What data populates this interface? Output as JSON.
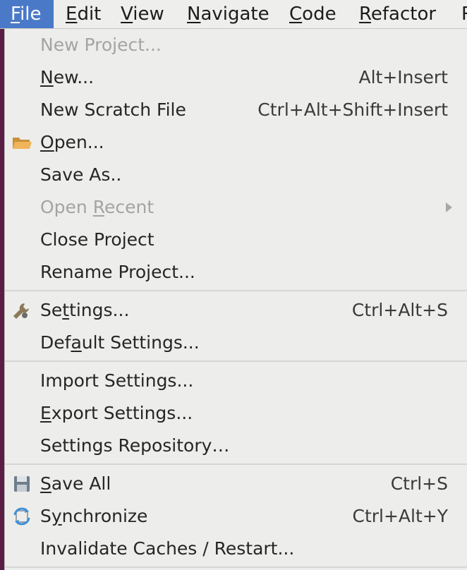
{
  "menubar": {
    "items": [
      {
        "label": "File",
        "mn": "F",
        "rest": "ile"
      },
      {
        "label": "Edit",
        "mn": "E",
        "rest": "dit"
      },
      {
        "label": "View",
        "mn": "V",
        "rest": "iew"
      },
      {
        "label": "Navigate",
        "mn": "N",
        "rest": "avigate"
      },
      {
        "label": "Code",
        "mn": "C",
        "rest": "ode"
      },
      {
        "label": "Refactor",
        "mn": "R",
        "rest": "efactor"
      },
      {
        "label": "R",
        "mn": "",
        "rest": "R"
      }
    ]
  },
  "file_menu": {
    "items": [
      {
        "label": "New Project...",
        "pre": "New Project...",
        "mn": "",
        "post": "",
        "shortcut": "",
        "disabled": true
      },
      {
        "label": "New...",
        "pre": "",
        "mn": "N",
        "post": "ew...",
        "shortcut": "Alt+Insert",
        "disabled": false
      },
      {
        "label": "New Scratch File",
        "pre": "New Scratch File",
        "mn": "",
        "post": "",
        "shortcut": "Ctrl+Alt+Shift+Insert",
        "disabled": false
      },
      {
        "label": "Open...",
        "pre": "",
        "mn": "O",
        "post": "pen...",
        "shortcut": "",
        "icon": "folder-icon",
        "disabled": false
      },
      {
        "label": "Save As..",
        "pre": "Save As..",
        "mn": "",
        "post": "",
        "shortcut": "",
        "disabled": false
      },
      {
        "label": "Open Recent",
        "pre": "Open ",
        "mn": "R",
        "post": "ecent",
        "shortcut": "",
        "submenu": true,
        "disabled": true
      },
      {
        "label": "Close Project",
        "pre": "Close Project",
        "mn": "",
        "post": "",
        "shortcut": "",
        "disabled": false
      },
      {
        "label": "Rename Project...",
        "pre": "Rename Project...",
        "mn": "",
        "post": "",
        "shortcut": "",
        "disabled": false
      },
      {
        "label": "Settings...",
        "pre": "Se",
        "mn": "t",
        "post": "tings...",
        "shortcut": "Ctrl+Alt+S",
        "icon": "wrench-icon",
        "disabled": false
      },
      {
        "label": "Default Settings...",
        "pre": "Def",
        "mn": "a",
        "post": "ult Settings...",
        "shortcut": "",
        "disabled": false
      },
      {
        "label": "Import Settings...",
        "pre": "Import Settings...",
        "mn": "",
        "post": "",
        "shortcut": "",
        "disabled": false
      },
      {
        "label": "Export Settings...",
        "pre": "",
        "mn": "E",
        "post": "xport Settings...",
        "shortcut": "",
        "disabled": false
      },
      {
        "label": "Settings Repository…",
        "pre": "Settings Repository…",
        "mn": "",
        "post": "",
        "shortcut": "",
        "disabled": false
      },
      {
        "label": "Save All",
        "pre": "",
        "mn": "S",
        "post": "ave All",
        "shortcut": "Ctrl+S",
        "icon": "save-icon",
        "disabled": false
      },
      {
        "label": "Synchronize",
        "pre": "S",
        "mn": "y",
        "post": "nchronize",
        "shortcut": "Ctrl+Alt+Y",
        "icon": "sync-icon",
        "disabled": false
      },
      {
        "label": "Invalidate Caches / Restart...",
        "pre": "Invalidate Caches / Restart...",
        "mn": "",
        "post": "",
        "shortcut": "",
        "disabled": false
      }
    ]
  },
  "colors": {
    "menubar_active": "#4a79c8",
    "menu_bg": "#ededeb",
    "disabled_text": "#a4a4a2",
    "desktop_bg": "#5a1d44"
  }
}
